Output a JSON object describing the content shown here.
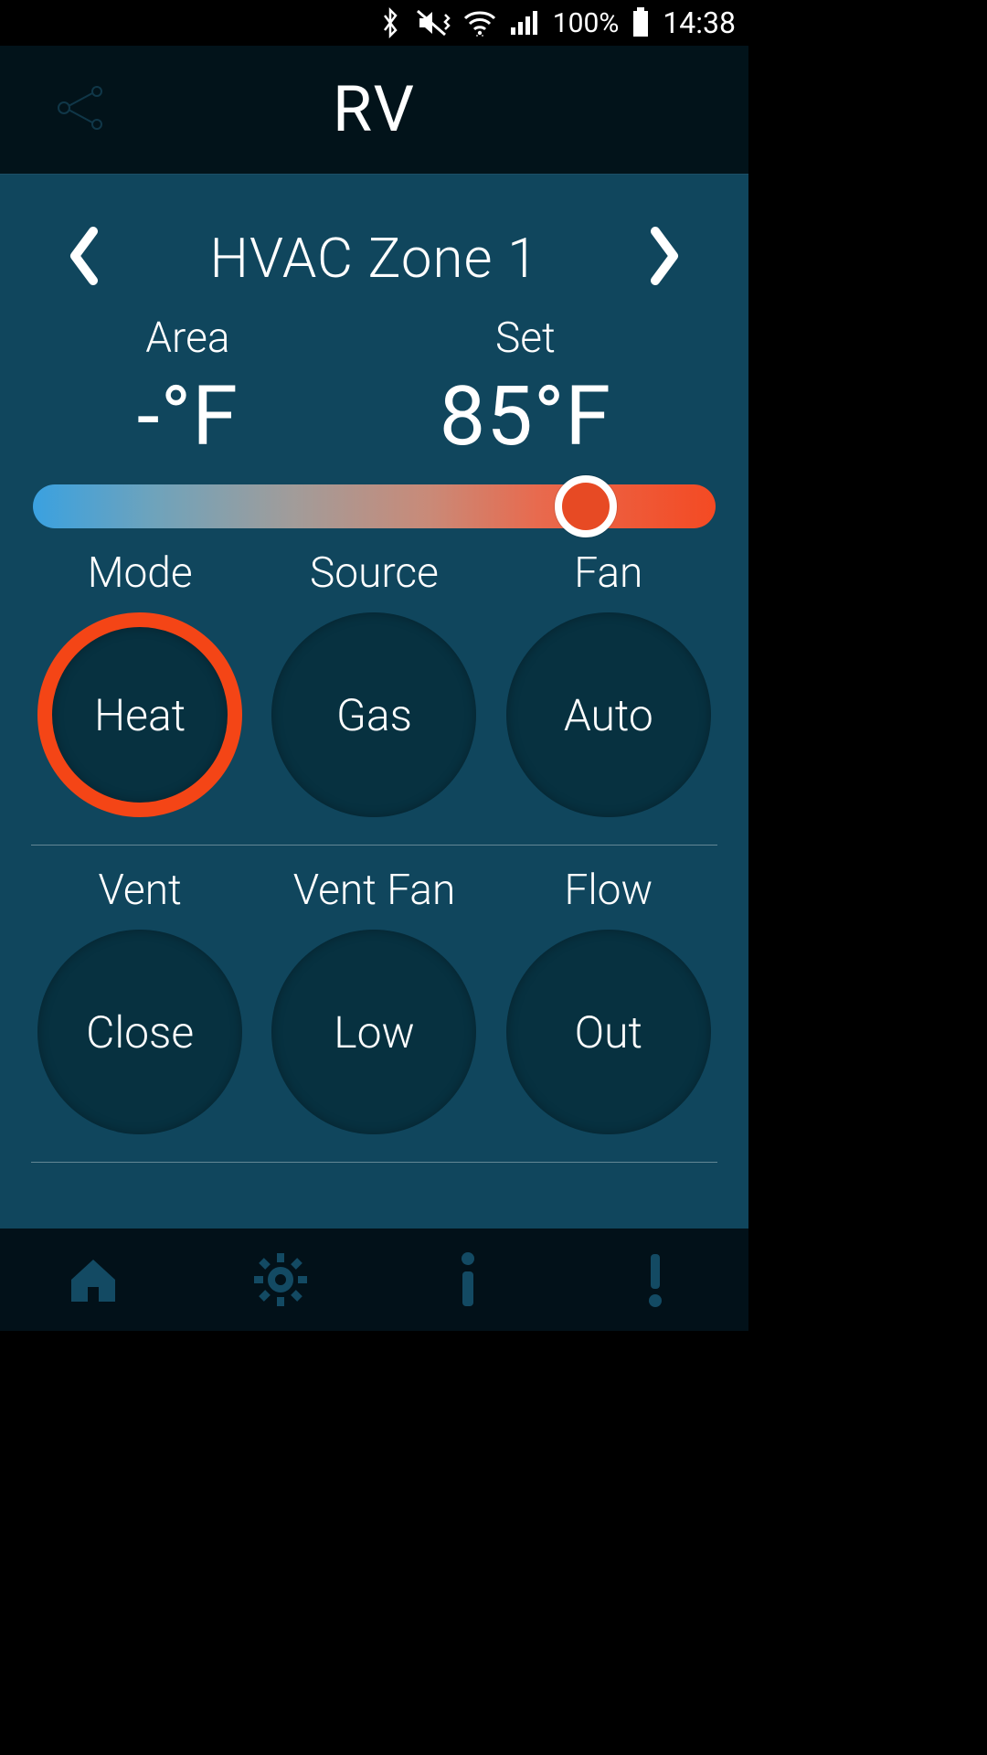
{
  "status": {
    "battery_pct": "100%",
    "time": "14:38"
  },
  "header": {
    "title": "RV"
  },
  "zone": {
    "title": "HVAC Zone 1",
    "area_label": "Area",
    "area_value": "-°F",
    "set_label": "Set",
    "set_value": "85°F"
  },
  "controls": {
    "row1": [
      {
        "label": "Mode",
        "value": "Heat",
        "active": true
      },
      {
        "label": "Source",
        "value": "Gas",
        "active": false
      },
      {
        "label": "Fan",
        "value": "Auto",
        "active": false
      }
    ],
    "row2": [
      {
        "label": "Vent",
        "value": "Close",
        "active": false
      },
      {
        "label": "Vent Fan",
        "value": "Low",
        "active": false
      },
      {
        "label": "Flow",
        "value": "Out",
        "active": false
      }
    ]
  },
  "colors": {
    "accent": "#f44516",
    "bg_main": "#10465d",
    "bg_dark": "#021119",
    "knob": "#073140"
  }
}
